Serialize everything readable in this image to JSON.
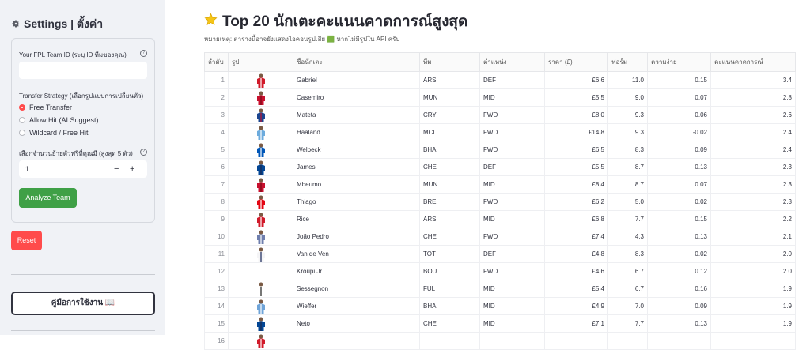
{
  "sidebar": {
    "title": "Settings | ตั้งค่า",
    "team_id_label": "Your FPL Team ID (ระบุ ID ทีมของคุณ)",
    "team_id_value": "",
    "strategy_label": "Transfer Strategy (เลือกรูปแบบการเปลี่ยนตัว)",
    "strategies": [
      {
        "label": "Free Transfer",
        "selected": true
      },
      {
        "label": "Allow Hit (AI Suggest)",
        "selected": false
      },
      {
        "label": "Wildcard / Free Hit",
        "selected": false
      }
    ],
    "num_transfers_label": "เลือกจำนวนย้ายตัวฟรีที่คุณมี (สูงสุด 5 ตัว)",
    "num_transfers_value": "1",
    "minus": "−",
    "plus": "+",
    "help_glyph": "?",
    "analyze_label": "Analyze Team",
    "reset_label": "Reset",
    "manual_label": "คู่มือการใช้งาน 📖"
  },
  "main": {
    "title": "Top 20 นักเตะคะแนนคาดการณ์สูงสุด",
    "note": "หมายเหตุ: ตารางนี้อาจยังแสดงไอคอนรูปเสีย 🟩 หากไม่มีรูปใน API ครับ",
    "columns": [
      "ลำดับ",
      "รูป",
      "ชื่อนักเตะ",
      "ทีม",
      "ตำแหน่ง",
      "ราคา (£)",
      "ฟอร์ม",
      "ความง่าย",
      "คะแนนคาดการณ์"
    ],
    "rows": [
      {
        "rank": "1",
        "name": "Gabriel",
        "team": "ARS",
        "pos": "DEF",
        "price": "£6.6",
        "form": "11.0",
        "ease": "0.15",
        "pred": "3.4",
        "kit": "#d11a2a",
        "kit2": "#ffffff"
      },
      {
        "rank": "2",
        "name": "Casemiro",
        "team": "MUN",
        "pos": "MID",
        "price": "£5.5",
        "form": "9.0",
        "ease": "0.07",
        "pred": "2.8",
        "kit": "#c8102e",
        "kit2": "#7a0c18"
      },
      {
        "rank": "3",
        "name": "Mateta",
        "team": "CRY",
        "pos": "FWD",
        "price": "£8.0",
        "form": "9.3",
        "ease": "0.06",
        "pred": "2.6",
        "kit": "#1b458f",
        "kit2": "#c4122e"
      },
      {
        "rank": "4",
        "name": "Haaland",
        "team": "MCI",
        "pos": "FWD",
        "price": "£14.8",
        "form": "9.3",
        "ease": "-0.02",
        "pred": "2.4",
        "kit": "#6cabdd",
        "kit2": "#ffffff"
      },
      {
        "rank": "5",
        "name": "Welbeck",
        "team": "BHA",
        "pos": "FWD",
        "price": "£6.5",
        "form": "8.3",
        "ease": "0.09",
        "pred": "2.4",
        "kit": "#0057b8",
        "kit2": "#ffffff"
      },
      {
        "rank": "6",
        "name": "James",
        "team": "CHE",
        "pos": "DEF",
        "price": "£5.5",
        "form": "8.7",
        "ease": "0.13",
        "pred": "2.3",
        "kit": "#034694",
        "kit2": "#1d2a52"
      },
      {
        "rank": "7",
        "name": "Mbeumo",
        "team": "MUN",
        "pos": "MID",
        "price": "£8.4",
        "form": "8.7",
        "ease": "0.07",
        "pred": "2.3",
        "kit": "#c8102e",
        "kit2": "#7a0c18"
      },
      {
        "rank": "8",
        "name": "Thiago",
        "team": "BRE",
        "pos": "FWD",
        "price": "£6.2",
        "form": "5.0",
        "ease": "0.02",
        "pred": "2.3",
        "kit": "#e30613",
        "kit2": "#ffffff"
      },
      {
        "rank": "9",
        "name": "Rice",
        "team": "ARS",
        "pos": "MID",
        "price": "£6.8",
        "form": "7.7",
        "ease": "0.15",
        "pred": "2.2",
        "kit": "#d11a2a",
        "kit2": "#ffffff"
      },
      {
        "rank": "10",
        "name": "João Pedro",
        "team": "CHE",
        "pos": "FWD",
        "price": "£7.4",
        "form": "4.3",
        "ease": "0.13",
        "pred": "2.1",
        "kit": "#6f7fae",
        "kit2": "#ffffff"
      },
      {
        "rank": "11",
        "name": "Van de Ven",
        "team": "TOT",
        "pos": "DEF",
        "price": "£4.8",
        "form": "8.3",
        "ease": "0.02",
        "pred": "2.0",
        "kit": "#f4f4f6",
        "kit2": "#132257"
      },
      {
        "rank": "12",
        "name": "Kroupi.Jr",
        "team": "BOU",
        "pos": "FWD",
        "price": "£4.6",
        "form": "6.7",
        "ease": "0.12",
        "pred": "2.0",
        "kit": "",
        "kit2": ""
      },
      {
        "rank": "13",
        "name": "Sessegnon",
        "team": "FUL",
        "pos": "MID",
        "price": "£5.4",
        "form": "6.7",
        "ease": "0.16",
        "pred": "1.9",
        "kit": "#ffffff",
        "kit2": "#1d1d1b"
      },
      {
        "rank": "14",
        "name": "Wieffer",
        "team": "BHA",
        "pos": "MID",
        "price": "£4.9",
        "form": "7.0",
        "ease": "0.09",
        "pred": "1.9",
        "kit": "#6fa4d8",
        "kit2": "#ffffff"
      },
      {
        "rank": "15",
        "name": "Neto",
        "team": "CHE",
        "pos": "MID",
        "price": "£7.1",
        "form": "7.7",
        "ease": "0.13",
        "pred": "1.9",
        "kit": "#034694",
        "kit2": "#1d2a52"
      },
      {
        "rank": "16",
        "name": "",
        "team": "",
        "pos": "",
        "price": "",
        "form": "",
        "ease": "",
        "pred": "",
        "kit": "#d11a2a",
        "kit2": "#ffffff"
      }
    ]
  }
}
